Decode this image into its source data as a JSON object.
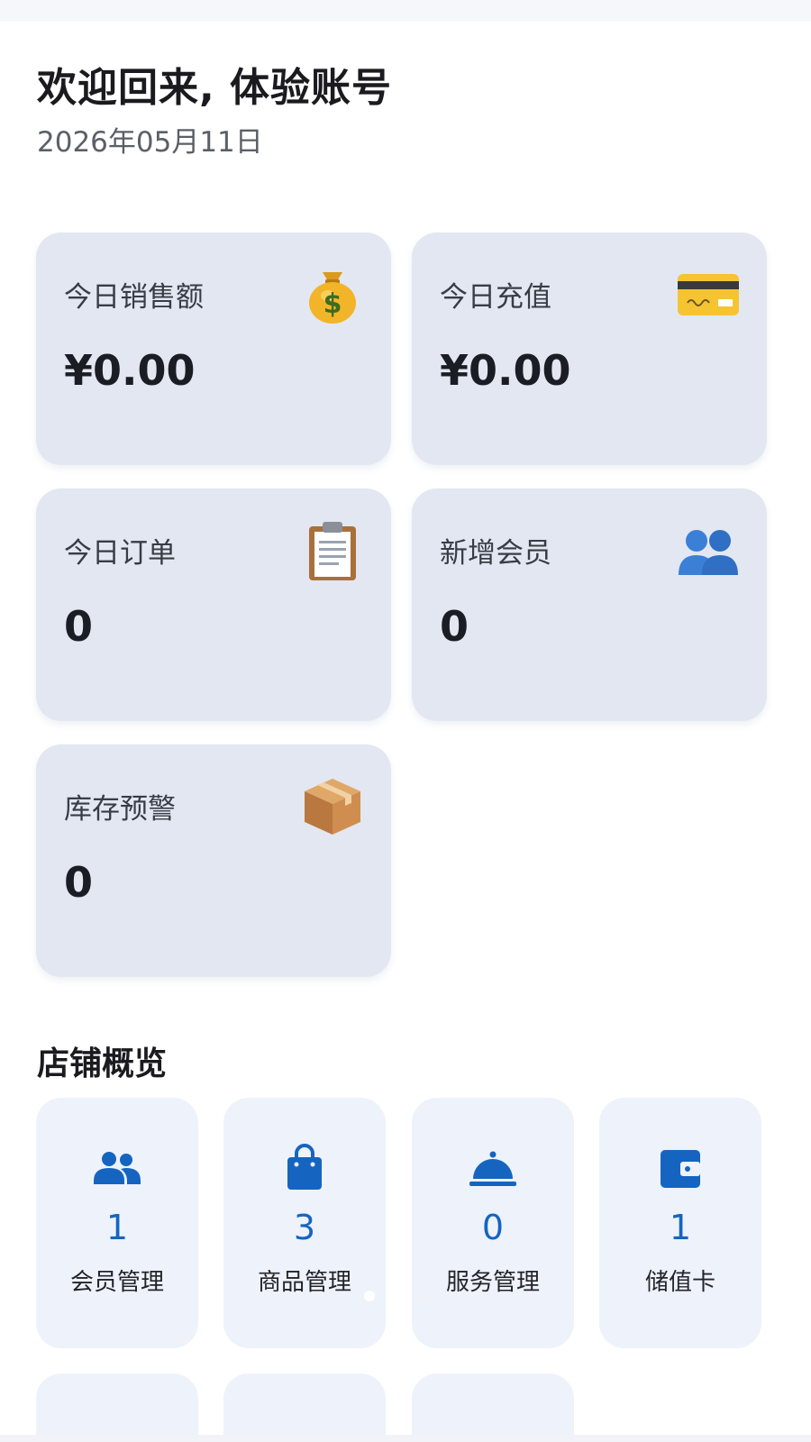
{
  "header": {
    "greeting": "欢迎回来, 体验账号",
    "date": "2026年05月11日"
  },
  "stats": [
    {
      "label": "今日销售额",
      "value": "¥0.00",
      "icon": "money-bag-icon"
    },
    {
      "label": "今日充值",
      "value": "¥0.00",
      "icon": "credit-card-icon"
    },
    {
      "label": "今日订单",
      "value": "0",
      "icon": "clipboard-icon"
    },
    {
      "label": "新增会员",
      "value": "0",
      "icon": "members-icon"
    },
    {
      "label": "库存预警",
      "value": "0",
      "icon": "package-icon"
    }
  ],
  "overview": {
    "title": "店铺概览",
    "tiles": [
      {
        "label": "会员管理",
        "count": "1",
        "icon": "people-icon"
      },
      {
        "label": "商品管理",
        "count": "3",
        "icon": "shopping-bag-icon"
      },
      {
        "label": "服务管理",
        "count": "0",
        "icon": "service-bell-icon"
      },
      {
        "label": "储值卡",
        "count": "1",
        "icon": "wallet-icon"
      }
    ]
  },
  "colors": {
    "card_bg": "#e2e7f1",
    "tile_bg": "#eef2fb",
    "accent": "#1565c0"
  }
}
